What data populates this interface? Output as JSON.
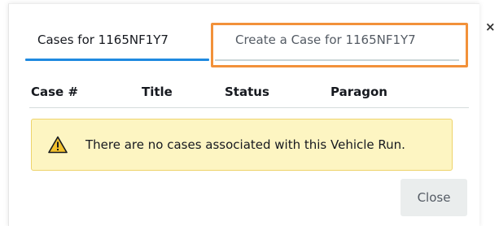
{
  "tabs": [
    {
      "label": "Cases for 1165NF1Y7",
      "active": true
    },
    {
      "label": "Create a Case for 1165NF1Y7",
      "active": false
    }
  ],
  "table": {
    "columns": [
      "Case #",
      "Title",
      "Status",
      "Paragon"
    ]
  },
  "alert": {
    "icon": "warning-triangle-icon",
    "message": "There are no cases associated with this Vehicle Run."
  },
  "footer": {
    "close_label": "Close"
  },
  "dialog": {
    "dismiss_glyph": "×"
  },
  "colors": {
    "active_tab_underline": "#1f8ae0",
    "highlight_outline": "#f2913a",
    "alert_background": "#fdf5c2",
    "alert_border": "#eed36a",
    "warning_icon_fill": "#f2c12e"
  }
}
